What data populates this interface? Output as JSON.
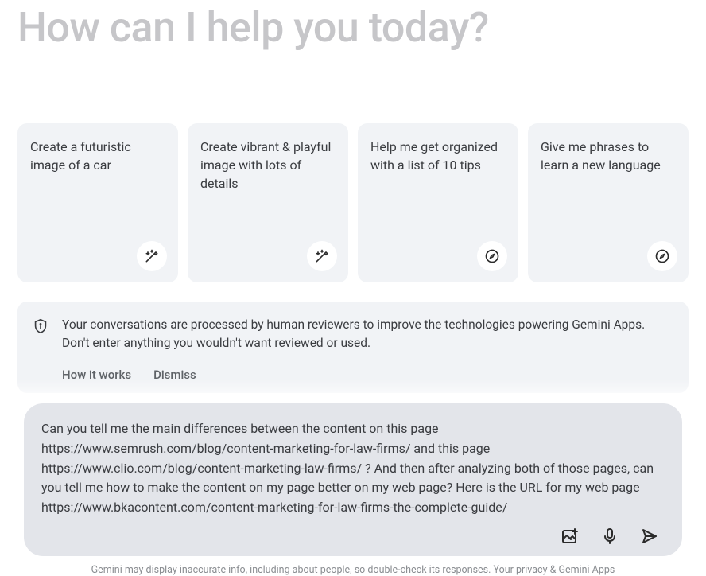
{
  "hero": {
    "title": "How can I help you today?"
  },
  "cards": [
    {
      "text": "Create a futuristic image of a car",
      "icon": "magic-pen"
    },
    {
      "text": "Create vibrant & playful image with lots of details",
      "icon": "magic-pen"
    },
    {
      "text": "Help me get organized with a list of 10 tips",
      "icon": "compass"
    },
    {
      "text": "Give me phrases to learn a new language",
      "icon": "compass"
    }
  ],
  "notice": {
    "text": "Your conversations are processed by human reviewers to improve the technologies powering Gemini Apps. Don't enter anything you wouldn't want reviewed or used.",
    "how_it_works": "How it works",
    "dismiss": "Dismiss"
  },
  "composer": {
    "value": "Can you tell me the main differences between the content on this page https://www.semrush.com/blog/content-marketing-for-law-firms/ and this page https://www.clio.com/blog/content-marketing-law-firms/ ? And then after analyzing both of those pages, can you tell me how to make the content on my page better on my web page? Here is the URL for my web page https://www.bkacontent.com/content-marketing-for-law-firms-the-complete-guide/"
  },
  "footer": {
    "prefix": "Gemini may display inaccurate info, including about people, so double-check its responses. ",
    "link": "Your privacy & Gemini Apps"
  }
}
